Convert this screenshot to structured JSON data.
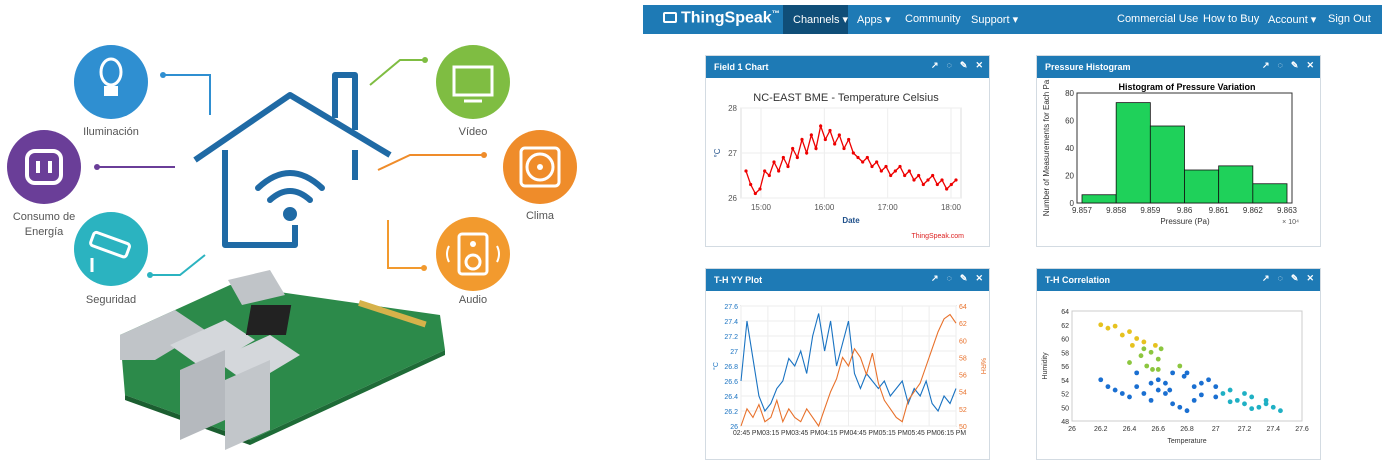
{
  "infographic": {
    "labels": {
      "iluminacion": "Iluminación",
      "consumo": "Consumo de Energía",
      "seguridad": "Seguridad",
      "video": "Vídeo",
      "clima": "Clima",
      "audio": "Audio"
    },
    "colors": {
      "blue": "#2f8fd1",
      "purple": "#6a3e98",
      "teal": "#2bb3c0",
      "green": "#7fbd42",
      "orange": "#ef8c2a",
      "orange2": "#f29a2e",
      "house": "#1f6aa5"
    }
  },
  "nav": {
    "logo": "ThingSpeak",
    "tm": "™",
    "items": [
      "Channels ▾",
      "Apps ▾",
      "Community",
      "Support ▾"
    ],
    "right_items": [
      "Commercial Use",
      "How to Buy",
      "Account ▾",
      "Sign Out"
    ]
  },
  "panels": [
    {
      "title": "Field 1 Chart"
    },
    {
      "title": "Pressure Histogram"
    },
    {
      "title": "T-H YY Plot"
    },
    {
      "title": "T-H Correlation"
    }
  ],
  "icons": [
    "external-link-icon",
    "comment-icon",
    "pencil-icon",
    "close-icon"
  ],
  "chart_data": [
    {
      "type": "line",
      "title": "NC-EAST BME - Temperature Celsius",
      "xlabel": "Date",
      "ylabel": "°C",
      "x_ticks": [
        "15:00",
        "16:00",
        "17:00",
        "18:00"
      ],
      "y_ticks": [
        "26",
        "27",
        "28"
      ],
      "ylim": [
        26,
        28
      ],
      "credit": "ThingSpeak.com",
      "series": [
        {
          "values": [
            26.6,
            26.3,
            26.1,
            26.2,
            26.6,
            26.5,
            26.8,
            26.6,
            26.9,
            26.7,
            27.1,
            26.9,
            27.3,
            27.0,
            27.4,
            27.1,
            27.6,
            27.3,
            27.5,
            27.2,
            27.4,
            27.1,
            27.3,
            27.0,
            26.9,
            26.8,
            26.9,
            26.7,
            26.8,
            26.6,
            26.7,
            26.5,
            26.6,
            26.7,
            26.5,
            26.6,
            26.4,
            26.5,
            26.3,
            26.4,
            26.5,
            26.3,
            26.4,
            26.2,
            26.3,
            26.4
          ]
        }
      ]
    },
    {
      "type": "bar",
      "title": "Histogram of Pressure Variation",
      "xlabel": "Pressure (Pa)",
      "ylabel": "Number of Measurements for Each Pa",
      "x_ticks": [
        "9.857",
        "9.858",
        "9.859",
        "9.86",
        "9.861",
        "9.862",
        "9.863"
      ],
      "x_multiplier": "× 10⁴",
      "y_ticks": [
        "0",
        "20",
        "40",
        "60",
        "80"
      ],
      "ylim": [
        0,
        80
      ],
      "values": [
        6,
        73,
        56,
        24,
        27,
        14
      ]
    },
    {
      "type": "line",
      "title": "",
      "ylabel_left": "°C",
      "ylabel_right": "%RH",
      "y_left_ticks": [
        "26",
        "26.2",
        "26.4",
        "26.6",
        "26.8",
        "27",
        "27.2",
        "27.4",
        "27.6"
      ],
      "y_right_ticks": [
        "50",
        "52",
        "54",
        "56",
        "58",
        "60",
        "62",
        "64"
      ],
      "x_tick_text": "02:45 PM03:15 PM03:45 PM04:15 PM04:45 PM05:15 PM05:45 PM06:15 PM",
      "series": [
        {
          "values": [
            26.6,
            27.4,
            26.9,
            26.4,
            26.2,
            26.3,
            26.5,
            26.6,
            26.9,
            26.8,
            27.0,
            26.7,
            27.2,
            27.5,
            27.0,
            27.4,
            26.8,
            27.1,
            27.4,
            26.7,
            26.5,
            26.7,
            26.6,
            26.5,
            26.6,
            26.4,
            26.5,
            26.6,
            26.3,
            26.5,
            26.4,
            26.6,
            26.3,
            26.2,
            26.4,
            26.3,
            26.5
          ]
        },
        {
          "values": [
            50.0,
            52.0,
            51.0,
            52.5,
            50.5,
            51.0,
            53.0,
            50.5,
            52.0,
            51.0,
            50.5,
            52.0,
            51.0,
            50.0,
            52.0,
            54.0,
            55.5,
            58.0,
            57.0,
            59.0,
            58.0,
            56.0,
            58.5,
            55.0,
            53.0,
            52.0,
            51.0,
            50.5,
            53.0,
            54.0,
            55.0,
            57.0,
            59.0,
            61.0,
            62.5,
            63.0,
            62.0
          ]
        }
      ]
    },
    {
      "type": "scatter",
      "xlabel": "Temperature",
      "ylabel": "Humidity",
      "x_ticks": [
        "26",
        "26.2",
        "26.4",
        "26.6",
        "26.8",
        "27",
        "27.2",
        "27.4",
        "27.6"
      ],
      "y_ticks": [
        "48",
        "50",
        "52",
        "54",
        "56",
        "58",
        "60",
        "62",
        "64"
      ],
      "xlim": [
        26,
        27.6
      ],
      "ylim": [
        48,
        64
      ],
      "points": [
        [
          26.2,
          62
        ],
        [
          26.25,
          61.5
        ],
        [
          26.3,
          61.8
        ],
        [
          26.35,
          60.5
        ],
        [
          26.4,
          61
        ],
        [
          26.42,
          59
        ],
        [
          26.45,
          60
        ],
        [
          26.5,
          58.5
        ],
        [
          26.5,
          59.5
        ],
        [
          26.55,
          58
        ],
        [
          26.6,
          57
        ],
        [
          26.58,
          59
        ],
        [
          26.62,
          58.5
        ],
        [
          26.48,
          57.5
        ],
        [
          26.4,
          56.5
        ],
        [
          26.45,
          55
        ],
        [
          26.52,
          56
        ],
        [
          26.56,
          55.5
        ],
        [
          26.6,
          54
        ],
        [
          26.65,
          53.5
        ],
        [
          26.7,
          55
        ],
        [
          26.75,
          56
        ],
        [
          26.8,
          55
        ],
        [
          26.78,
          54.5
        ],
        [
          26.85,
          53
        ],
        [
          26.9,
          53.5
        ],
        [
          26.95,
          54
        ],
        [
          27.0,
          53
        ],
        [
          27.05,
          52
        ],
        [
          27.1,
          52.5
        ],
        [
          27.15,
          51
        ],
        [
          27.2,
          50.5
        ],
        [
          27.25,
          51.5
        ],
        [
          27.3,
          50
        ],
        [
          27.35,
          50.5
        ],
        [
          27.4,
          50
        ],
        [
          27.45,
          49.5
        ],
        [
          26.2,
          54
        ],
        [
          26.25,
          53
        ],
        [
          26.3,
          52.5
        ],
        [
          26.35,
          52
        ],
        [
          26.4,
          51.5
        ],
        [
          26.5,
          52
        ],
        [
          26.55,
          51
        ],
        [
          26.6,
          52.5
        ],
        [
          26.7,
          50.5
        ],
        [
          26.75,
          50
        ],
        [
          26.8,
          49.5
        ],
        [
          26.85,
          51
        ],
        [
          26.65,
          52
        ],
        [
          26.45,
          53
        ],
        [
          26.55,
          53.5
        ],
        [
          26.6,
          55.5
        ],
        [
          26.68,
          52.5
        ],
        [
          27.0,
          51.5
        ],
        [
          27.1,
          50.8
        ],
        [
          26.9,
          51.8
        ],
        [
          27.25,
          49.8
        ],
        [
          27.35,
          51
        ],
        [
          27.2,
          52
        ]
      ]
    }
  ]
}
